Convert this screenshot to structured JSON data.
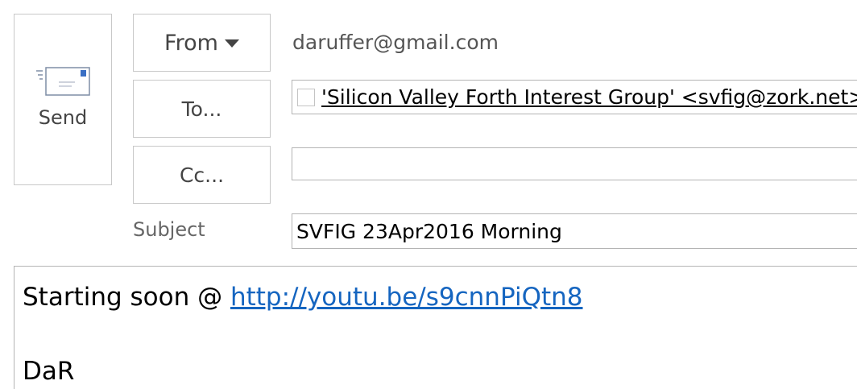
{
  "compose": {
    "send": {
      "label": "Send",
      "icon": "envelope-icon"
    },
    "from": {
      "label": "From",
      "icon": "caret-down-icon",
      "address": "daruffer@gmail.com"
    },
    "to": {
      "label": "To...",
      "recipients": [
        {
          "display": "'Silicon Valley Forth Interest Group' <svfig@zork.net>",
          "separator": ";"
        }
      ]
    },
    "cc": {
      "label": "Cc...",
      "value": ""
    },
    "subject": {
      "label": "Subject",
      "value": "SVFIG 23Apr2016 Morning"
    },
    "body": {
      "line1_prefix": "Starting soon @ ",
      "link": "http://youtu.be/s9cnnPiQtn8",
      "signature": "DaR"
    }
  },
  "colors": {
    "link": "#1565c0",
    "button_border": "#c8c8c8",
    "field_border": "#b4b4b4",
    "muted_text": "#666666"
  }
}
